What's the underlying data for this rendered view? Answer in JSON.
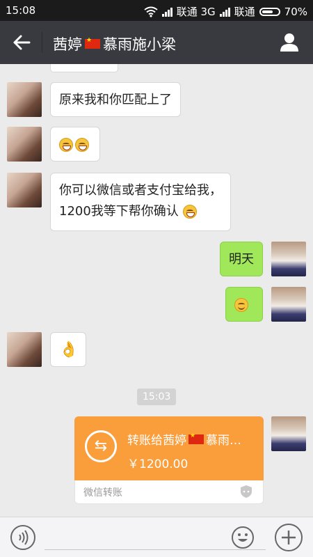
{
  "status_bar": {
    "time": "15:08",
    "carrier1": "联通 3G",
    "carrier2": "联通",
    "battery": "70%",
    "battery_level": 0.7
  },
  "header": {
    "contact_name_1": "茜婷",
    "contact_name_2": "慕雨施小梁"
  },
  "messages": {
    "m1": "原来我和你匹配上了",
    "m3_line1": "你可以微信或者支付宝给我，",
    "m3_line2": "1200我等下帮你确认",
    "m4": "明天"
  },
  "timestamp": "15:03",
  "transfer": {
    "title_prefix": "转账给茜婷",
    "title_suffix": "慕雨…",
    "amount": "￥1200.00",
    "footer": "微信转账"
  },
  "colors": {
    "header_bg": "#393a3f",
    "outgoing_bubble": "#a0e75a",
    "transfer_orange": "#fa9d3b"
  },
  "icons": [
    "back-arrow-icon",
    "person-icon",
    "grin-emoji-icon",
    "smile-emoji-icon",
    "ok-hand-emoji-icon",
    "transfer-arrows-icon",
    "shield-icon",
    "voice-icon",
    "emoji-icon",
    "plus-icon"
  ]
}
